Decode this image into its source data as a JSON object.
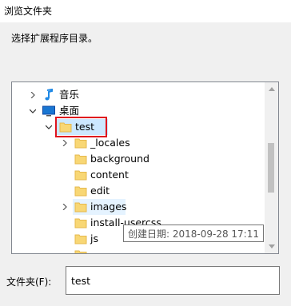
{
  "window": {
    "title": "浏览文件夹"
  },
  "instruction": "选择扩展程序目录。",
  "tree": {
    "items": [
      {
        "label": "音乐",
        "icon": "music-icon",
        "expander": "collapsed"
      },
      {
        "label": "桌面",
        "icon": "desktop-icon",
        "expander": "expanded"
      },
      {
        "label": "test",
        "icon": "folder-icon",
        "expander": "expanded",
        "selected": true,
        "highlighted": true
      },
      {
        "label": "_locales",
        "icon": "folder-icon",
        "expander": "collapsed"
      },
      {
        "label": "background",
        "icon": "folder-icon",
        "expander": "none"
      },
      {
        "label": "content",
        "icon": "folder-icon",
        "expander": "none"
      },
      {
        "label": "edit",
        "icon": "folder-icon",
        "expander": "none"
      },
      {
        "label": "images",
        "icon": "folder-icon",
        "expander": "collapsed",
        "hovered": true
      },
      {
        "label": "install-usercss",
        "icon": "folder-icon",
        "expander": "none"
      },
      {
        "label": "js",
        "icon": "folder-icon",
        "expander": "none"
      },
      {
        "label": "",
        "icon": "folder-icon",
        "expander": "none"
      }
    ],
    "tooltip": "创建日期: 2018-09-28 17:11"
  },
  "folder_field": {
    "label": "文件夹(F):",
    "value": "test"
  },
  "colors": {
    "folder": "#f8d775",
    "folder_dark": "#e6b94d",
    "selection": "#cce8ff",
    "hover": "#e5f3ff",
    "annotation_box": "#e0141e",
    "music_note": "#1e88e5",
    "desktop": "#1976d2"
  }
}
